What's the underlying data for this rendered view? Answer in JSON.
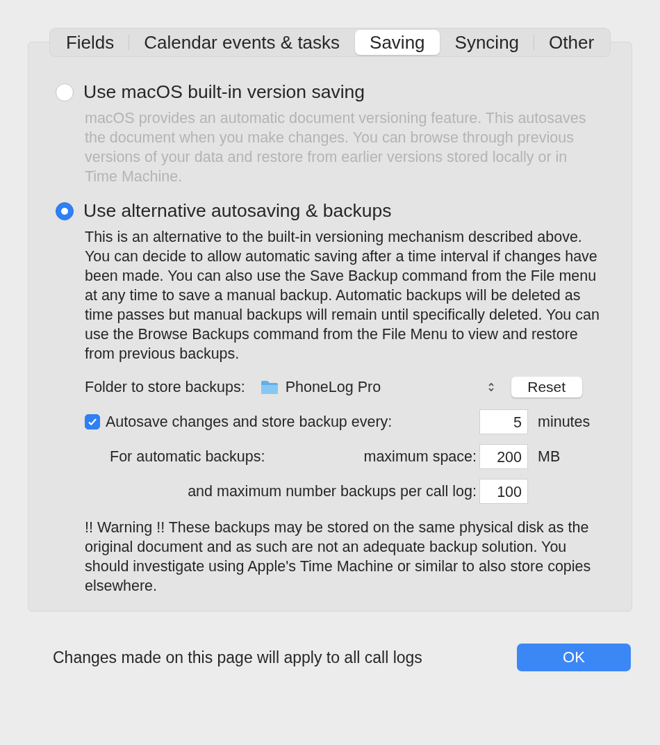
{
  "tabs": [
    {
      "label": "Fields",
      "selected": false
    },
    {
      "label": "Calendar events & tasks",
      "selected": false
    },
    {
      "label": "Saving",
      "selected": true
    },
    {
      "label": "Syncing",
      "selected": false
    },
    {
      "label": "Other",
      "selected": false
    }
  ],
  "options": [
    {
      "label": "Use macOS built-in version saving",
      "selected": false,
      "description": "macOS provides an automatic document versioning feature. This autosaves the document when you make changes. You can browse through previous versions of your data and restore from earlier versions stored locally or in Time Machine."
    },
    {
      "label": "Use alternative autosaving & backups",
      "selected": true,
      "description": "This is an alternative to the built-in versioning mechanism described above. You can decide to allow automatic saving after a time interval if changes have been made.  You can also use the Save Backup command from the File menu at any time to save a manual backup. Automatic backups will be deleted as time passes but manual backups will remain until specifically deleted. You can use the Browse Backups command from the File Menu to view and restore from previous backups."
    }
  ],
  "folder": {
    "label": "Folder to store backups:",
    "value": "PhoneLog Pro",
    "reset_button": "Reset"
  },
  "autosave": {
    "label": "Autosave changes and store backup every:",
    "checked": true,
    "value": "5",
    "unit": "minutes"
  },
  "automatic": {
    "label": "For automatic backups:",
    "sublabel": "maximum space:",
    "value": "200",
    "unit": "MB"
  },
  "max_number": {
    "label": "and maximum number backups per call log:",
    "value": "100"
  },
  "warning": "!! Warning !!  These backups may be stored on the same physical disk as the original document and as such are not an adequate backup solution.  You should investigate using Apple's Time Machine or similar to also store copies elsewhere.",
  "footer": {
    "note": "Changes made on this page will apply to all call logs",
    "ok_button": "OK"
  }
}
